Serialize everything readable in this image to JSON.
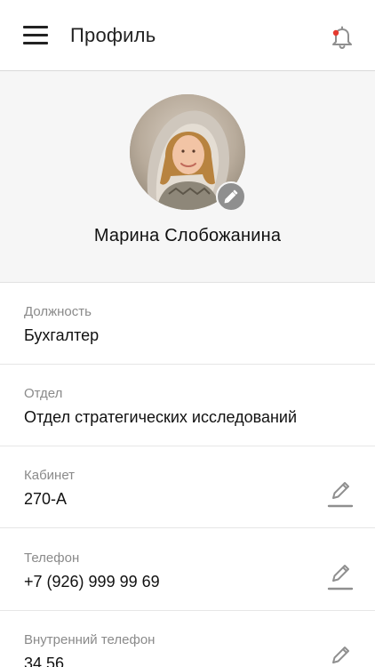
{
  "header": {
    "title": "Профиль",
    "menu_icon": "hamburger-menu-icon",
    "notification_icon": "bell-icon",
    "notification_dot_color": "#e53a2f"
  },
  "profile": {
    "name": "Марина Слобожанина",
    "avatar_alt": "avatar",
    "avatar_edit_icon": "pencil-icon"
  },
  "fields": [
    {
      "label": "Должность",
      "value": "Бухгалтер",
      "editable": false
    },
    {
      "label": "Отдел",
      "value": "Отдел стратегических исследований",
      "editable": false
    },
    {
      "label": "Кабинет",
      "value": "270-А",
      "editable": true
    },
    {
      "label": "Телефон",
      "value": "+7 (926) 999 99 69",
      "editable": true
    },
    {
      "label": "Внутренний телефон",
      "value": "34 56",
      "editable": true
    }
  ],
  "colors": {
    "accent_red": "#e53a2f",
    "icon_gray": "#8f8f8f",
    "label_gray": "#8a8a8a"
  }
}
